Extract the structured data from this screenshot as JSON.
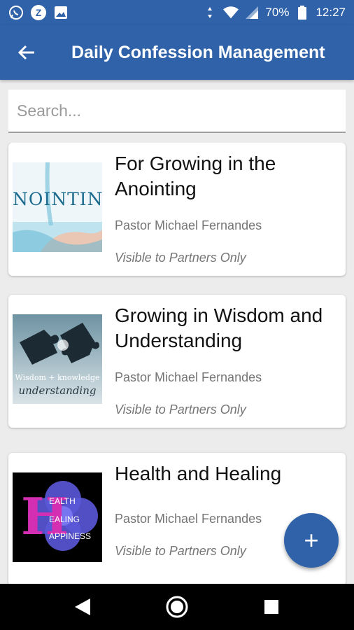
{
  "status_bar": {
    "battery": "70%",
    "time": "12:27",
    "icons": [
      "whatsapp-icon",
      "z-app-icon",
      "image-icon",
      "vibrate-icon",
      "wifi-icon",
      "signal-icon",
      "battery-icon"
    ],
    "z_letter": "Z"
  },
  "app_bar": {
    "title": "Daily Confession Management",
    "back_icon": "arrow-left-icon"
  },
  "search": {
    "placeholder": "Search...",
    "value": ""
  },
  "confessions": [
    {
      "title": "For Growing in the Anointing",
      "author": "Pastor Michael Fernandes",
      "visibility": "Visible to Partners Only",
      "thumbnail_text": "NOINTIN"
    },
    {
      "title": "Growing in Wisdom and Understanding",
      "author": "Pastor Michael Fernandes",
      "visibility": "Visible to Partners Only",
      "thumbnail_text": "Wisdom + knowledge",
      "thumbnail_subtext": "understanding"
    },
    {
      "title": "Health and Healing",
      "author": "Pastor Michael Fernandes",
      "visibility": "Visible to Partners Only",
      "thumbnail_letter": "H",
      "thumbnail_lines": [
        "EALTH",
        "EALING",
        "APPINESS"
      ]
    }
  ],
  "fab": {
    "icon": "plus-icon",
    "label": "+"
  },
  "nav_bar": {
    "icons": [
      "back-triangle-icon",
      "home-circle-icon",
      "recents-square-icon"
    ]
  },
  "colors": {
    "primary": "#2f62a9",
    "background": "#ececec"
  }
}
